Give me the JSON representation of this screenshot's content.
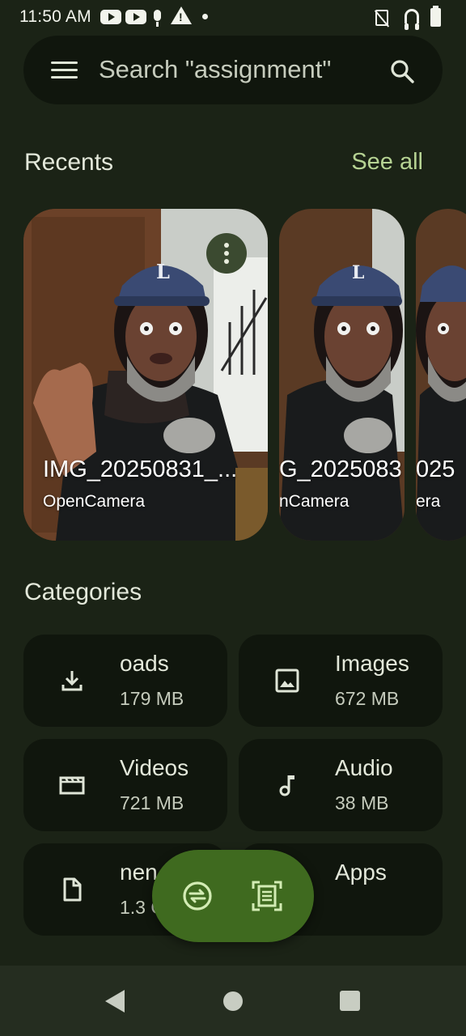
{
  "status_bar": {
    "time": "11:50 AM",
    "icons": [
      "youtube-icon",
      "youtube-icon",
      "mic-icon",
      "warning-icon",
      "dot-icon",
      "no-sim-icon",
      "headset-icon",
      "battery-icon"
    ]
  },
  "search": {
    "placeholder": "Search \"assignment\"",
    "icons": [
      "menu-icon",
      "search-icon"
    ]
  },
  "recents": {
    "title": "Recents",
    "see_all": "See all",
    "items": [
      {
        "name": "IMG_20250831_...",
        "source": "OpenCamera"
      },
      {
        "name": "G_2025083",
        "source": "nCamera"
      },
      {
        "name": "025",
        "source": "era"
      }
    ]
  },
  "categories": {
    "title": "Categories",
    "items": [
      {
        "name": "oads",
        "size": "179 MB",
        "icon": "download-icon"
      },
      {
        "name": "Images",
        "size": "672 MB",
        "icon": "image-icon"
      },
      {
        "name": "Videos",
        "size": "721 MB",
        "icon": "movie-icon"
      },
      {
        "name": "Audio",
        "size": "38 MB",
        "icon": "music-note-icon"
      },
      {
        "name": "nen",
        "size": "1.3 G",
        "icon": "document-icon"
      },
      {
        "name": "Apps",
        "size": "",
        "icon": "apps-icon"
      }
    ]
  },
  "fab": {
    "icons": [
      "switch-icon",
      "scan-document-icon"
    ]
  },
  "nav": {
    "icons": [
      "back-icon",
      "home-icon",
      "recents-icon"
    ]
  },
  "colors": {
    "background": "#1b2316",
    "card": "#10160d",
    "accent": "#b6d393",
    "fab": "#3f6a1f"
  }
}
